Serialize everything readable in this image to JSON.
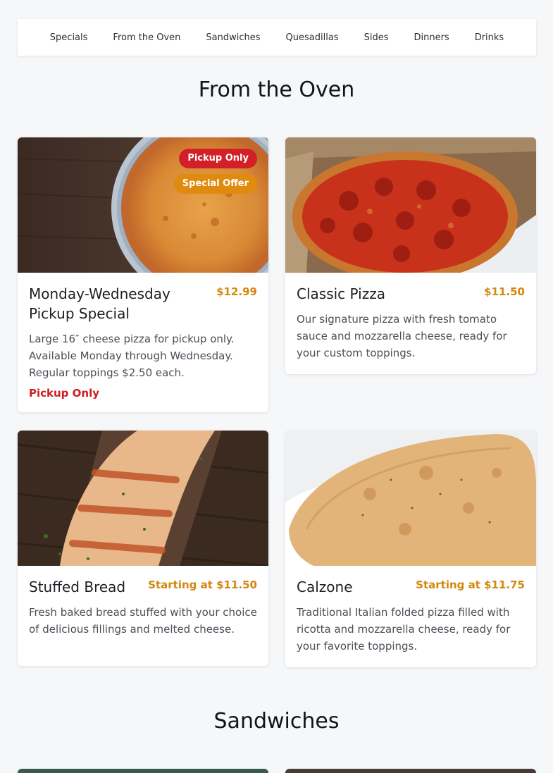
{
  "nav": {
    "items": [
      "Specials",
      "From the Oven",
      "Sandwiches",
      "Quesadillas",
      "Sides",
      "Dinners",
      "Drinks"
    ]
  },
  "sections": {
    "oven_title": "From the Oven",
    "sandwiches_title": "Sandwiches"
  },
  "items": [
    {
      "name": "Monday-Wednesday Pickup Special",
      "price": "$12.99",
      "description": "Large 16″ cheese pizza for pickup only. Available Monday through Wednesday. Regular toppings $2.50 each.",
      "note": "Pickup Only",
      "badges": [
        "Pickup Only",
        "Special Offer"
      ]
    },
    {
      "name": "Classic Pizza",
      "price": "$11.50",
      "description": "Our signature pizza with fresh tomato sauce and mozzarella cheese, ready for your custom toppings."
    },
    {
      "name": "Stuffed Bread",
      "price": "Starting at $11.50",
      "description": "Fresh baked bread stuffed with your choice of delicious fillings and melted cheese."
    },
    {
      "name": "Calzone",
      "price": "Starting at $11.75",
      "description": "Traditional Italian folded pizza filled with ricotta and mozzarella cheese, ready for your favorite toppings."
    }
  ],
  "colors": {
    "price": "#d4860f",
    "badge_red": "#d32026",
    "badge_orange": "#e08a10",
    "note_red": "#cc1f1f"
  }
}
